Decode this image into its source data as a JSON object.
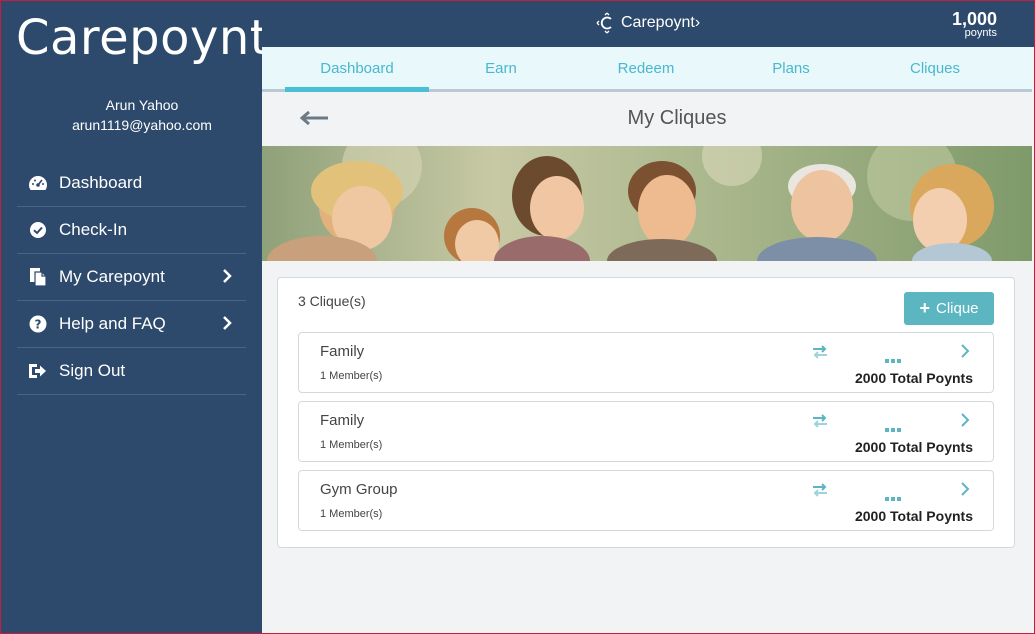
{
  "app": {
    "logo_text": "Carepoynt›",
    "brand_small": "Carepoynt›"
  },
  "user": {
    "name": "Arun Yahoo",
    "email": "arun1119@yahoo.com"
  },
  "sidebar": {
    "items": [
      {
        "label": "Dashboard",
        "icon": "speedometer-icon",
        "has_chevron": false
      },
      {
        "label": "Check-In",
        "icon": "check-circle-icon",
        "has_chevron": false
      },
      {
        "label": "My Carepoynt",
        "icon": "documents-icon",
        "has_chevron": true
      },
      {
        "label": "Help and FAQ",
        "icon": "question-circle-icon",
        "has_chevron": true
      },
      {
        "label": "Sign Out",
        "icon": "sign-out-icon",
        "has_chevron": false
      }
    ]
  },
  "points": {
    "value": "1,000",
    "label": "poynts"
  },
  "tabs": [
    {
      "label": "Dashboard",
      "active": true
    },
    {
      "label": "Earn",
      "active": false
    },
    {
      "label": "Redeem",
      "active": false
    },
    {
      "label": "Plans",
      "active": false
    },
    {
      "label": "Cliques",
      "active": false
    }
  ],
  "page": {
    "title": "My Cliques"
  },
  "cliques": {
    "count_label": "3 Clique(s)",
    "add_label": "Clique",
    "items": [
      {
        "name": "Family",
        "members": "1 Member(s)",
        "total": "2000 Total Poynts"
      },
      {
        "name": "Family",
        "members": "1 Member(s)",
        "total": "2000 Total Poynts"
      },
      {
        "name": "Gym Group",
        "members": "1 Member(s)",
        "total": "2000 Total Poynts"
      }
    ]
  },
  "colors": {
    "sidebar": "#2d4a6c",
    "accent": "#49c0d6",
    "button": "#5bb6c2",
    "tabs_bg": "#e8f8fb"
  }
}
